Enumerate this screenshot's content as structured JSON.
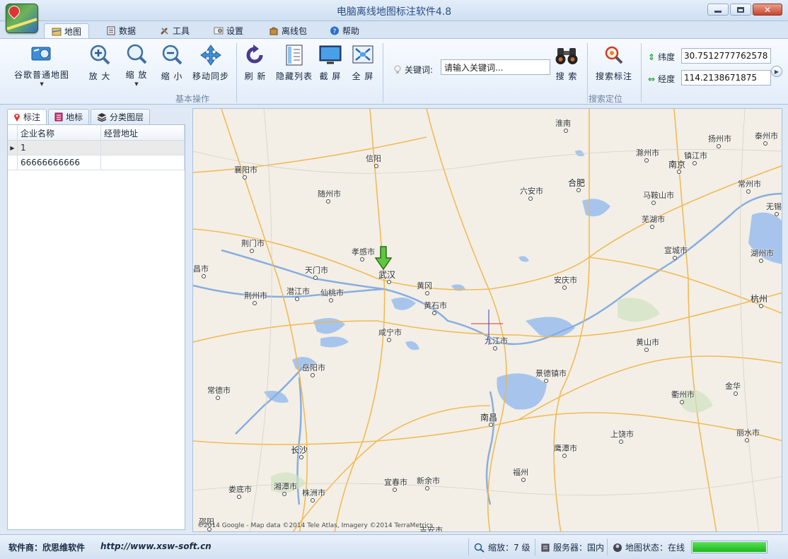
{
  "window": {
    "title": "电脑离线地图标注软件4.8",
    "app_icon": "map-app-icon"
  },
  "tabs": [
    {
      "label": "地图",
      "icon": "map-tab-icon",
      "active": true
    },
    {
      "label": "数据",
      "icon": "data-tab-icon",
      "active": false
    },
    {
      "label": "工具",
      "icon": "tools-tab-icon",
      "active": false
    },
    {
      "label": "设置",
      "icon": "settings-tab-icon",
      "active": false
    },
    {
      "label": "离线包",
      "icon": "package-tab-icon",
      "active": false
    },
    {
      "label": "帮助",
      "icon": "help-tab-icon",
      "active": false
    }
  ],
  "toolbar": {
    "map_type": "谷歌普通地图",
    "zoom_in": "放 大",
    "zoom": "缩 放",
    "zoom_out": "缩 小",
    "move_sync": "移动同步",
    "refresh": "刷 新",
    "hide_list": "隐藏列表",
    "screenshot": "截 屏",
    "fullscreen": "全 屏",
    "group_basic": "基本操作",
    "keyword_label": "关键词:",
    "keyword_value": "请输入关键词...",
    "search": "搜 索",
    "search_mark": "搜索标注",
    "group_search": "搜索定位",
    "lat_label": "纬度",
    "lat_value": "30.7512777762578",
    "lng_label": "经度",
    "lng_value": "114.2138671875"
  },
  "panel": {
    "tabs": [
      "标注",
      "地标",
      "分类图层"
    ],
    "columns": [
      "企业名称",
      "经营地址"
    ],
    "rows": [
      {
        "name": "1",
        "address": "",
        "selected": true
      },
      {
        "name": "66666666666",
        "address": "",
        "selected": false
      }
    ]
  },
  "map": {
    "cities": [
      {
        "name": "淮南",
        "major": false
      },
      {
        "name": "扬州市",
        "major": false
      },
      {
        "name": "泰州市",
        "major": false
      },
      {
        "name": "滁州市",
        "major": false
      },
      {
        "name": "镇江市",
        "major": false
      },
      {
        "name": "信阳",
        "major": false
      },
      {
        "name": "南京",
        "major": true
      },
      {
        "name": "襄阳市",
        "major": false
      },
      {
        "name": "合肥",
        "major": true
      },
      {
        "name": "常州市",
        "major": false
      },
      {
        "name": "随州市",
        "major": false
      },
      {
        "name": "六安市",
        "major": false
      },
      {
        "name": "马鞍山市",
        "major": false
      },
      {
        "name": "无锡",
        "major": false
      },
      {
        "name": "芜湖市",
        "major": false
      },
      {
        "name": "荆门市",
        "major": false
      },
      {
        "name": "孝感市",
        "major": false
      },
      {
        "name": "宣城市",
        "major": false
      },
      {
        "name": "湖州市",
        "major": false
      },
      {
        "name": "昌市",
        "major": false
      },
      {
        "name": "天门市",
        "major": false
      },
      {
        "name": "武汉",
        "major": true
      },
      {
        "name": "安庆市",
        "major": false
      },
      {
        "name": "黄冈",
        "major": false
      },
      {
        "name": "荆州市",
        "major": false
      },
      {
        "name": "潜江市",
        "major": false
      },
      {
        "name": "仙桃市",
        "major": false
      },
      {
        "name": "杭州",
        "major": true
      },
      {
        "name": "黄石市",
        "major": false
      },
      {
        "name": "咸宁市",
        "major": false
      },
      {
        "name": "九江市",
        "major": false
      },
      {
        "name": "黄山市",
        "major": false
      },
      {
        "name": "岳阳市",
        "major": false
      },
      {
        "name": "景德镇市",
        "major": false
      },
      {
        "name": "常德市",
        "major": false
      },
      {
        "name": "衢州市",
        "major": false
      },
      {
        "name": "金华",
        "major": false
      },
      {
        "name": "南昌",
        "major": true
      },
      {
        "name": "丽水市",
        "major": false
      },
      {
        "name": "上饶市",
        "major": false
      },
      {
        "name": "长沙",
        "major": true
      },
      {
        "name": "鹰潭市",
        "major": false
      },
      {
        "name": "福州",
        "major": false
      },
      {
        "name": "湘潭市",
        "major": false
      },
      {
        "name": "宜春市",
        "major": false
      },
      {
        "name": "新余市",
        "major": false
      },
      {
        "name": "娄底市",
        "major": false
      },
      {
        "name": "株洲市",
        "major": false
      },
      {
        "name": "邵阳",
        "major": false
      },
      {
        "name": "吉安市",
        "major": false
      }
    ],
    "attribution": "©2014 Google - Map data ©2014 Tele Atlas, Imagery ©2014 TerraMetrics"
  },
  "status": {
    "vendor": "软件商：欣思维软件",
    "website": "http://www.xsw-soft.cn",
    "zoom": "缩放：7 级",
    "server": "服务器：国内",
    "map_state": "地图状态：在线",
    "progress": 1.0
  }
}
